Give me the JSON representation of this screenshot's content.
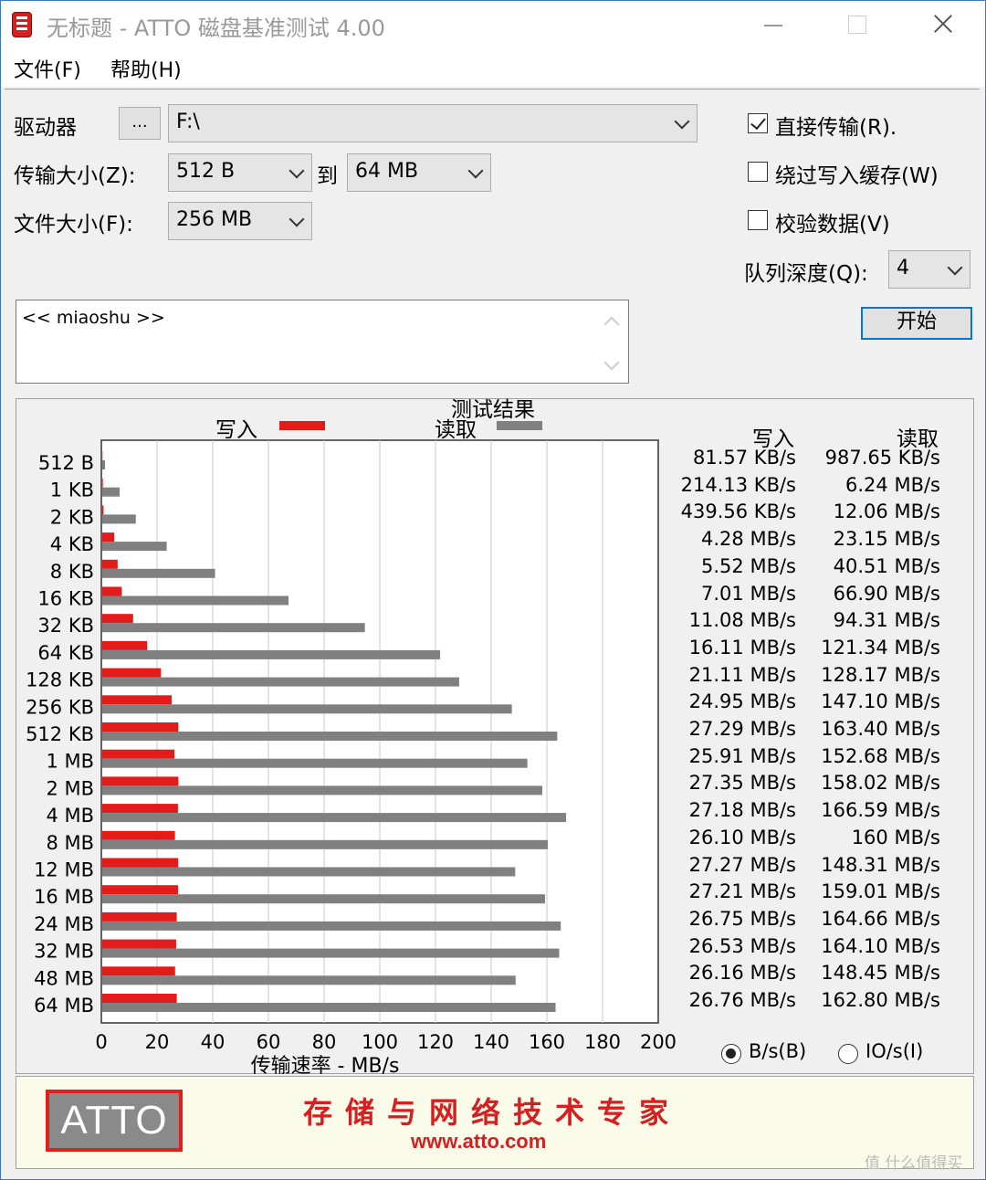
{
  "window": {
    "title": "无标题 - ATTO 磁盘基准测试 4.00"
  },
  "menu": [
    "文件(F)",
    "帮助(H)"
  ],
  "form": {
    "drive_label": "驱动器",
    "browse_button": "...",
    "drive_value": "F:\\",
    "transfer_size_label": "传输大小(Z):",
    "transfer_from": "512 B",
    "to_label": "到",
    "transfer_to": "64 MB",
    "file_size_label": "文件大小(F):",
    "file_size": "256 MB",
    "direct_io_label": "直接传输(R).",
    "direct_io_checked": true,
    "bypass_cache_label": "绕过写入缓存(W)",
    "bypass_cache_checked": false,
    "verify_label": "校验数据(V)",
    "verify_checked": false,
    "queue_depth_label": "队列深度(Q):",
    "queue_depth": "4",
    "start_button": "开始",
    "description": "<< miaoshu >>"
  },
  "results": {
    "title": "测试结果",
    "write_legend": "写入",
    "read_legend": "读取",
    "write_header": "写入",
    "read_header": "读取",
    "x_axis_label": "传输速率 - MB/s",
    "unit_bytes_label": "B/s(B)",
    "unit_io_label": "IO/s(I)",
    "unit_selected": "B/s",
    "rows": [
      {
        "size": "512 B",
        "write": "81.57 KB/s",
        "read": "987.65 KB/s"
      },
      {
        "size": "1 KB",
        "write": "214.13 KB/s",
        "read": "6.24 MB/s"
      },
      {
        "size": "2 KB",
        "write": "439.56 KB/s",
        "read": "12.06 MB/s"
      },
      {
        "size": "4 KB",
        "write": "4.28 MB/s",
        "read": "23.15 MB/s"
      },
      {
        "size": "8 KB",
        "write": "5.52 MB/s",
        "read": "40.51 MB/s"
      },
      {
        "size": "16 KB",
        "write": "7.01 MB/s",
        "read": "66.90 MB/s"
      },
      {
        "size": "32 KB",
        "write": "11.08 MB/s",
        "read": "94.31 MB/s"
      },
      {
        "size": "64 KB",
        "write": "16.11 MB/s",
        "read": "121.34 MB/s"
      },
      {
        "size": "128 KB",
        "write": "21.11 MB/s",
        "read": "128.17 MB/s"
      },
      {
        "size": "256 KB",
        "write": "24.95 MB/s",
        "read": "147.10 MB/s"
      },
      {
        "size": "512 KB",
        "write": "27.29 MB/s",
        "read": "163.40 MB/s"
      },
      {
        "size": "1 MB",
        "write": "25.91 MB/s",
        "read": "152.68 MB/s"
      },
      {
        "size": "2 MB",
        "write": "27.35 MB/s",
        "read": "158.02 MB/s"
      },
      {
        "size": "4 MB",
        "write": "27.18 MB/s",
        "read": "166.59 MB/s"
      },
      {
        "size": "8 MB",
        "write": "26.10 MB/s",
        "read": "160 MB/s"
      },
      {
        "size": "12 MB",
        "write": "27.27 MB/s",
        "read": "148.31 MB/s"
      },
      {
        "size": "16 MB",
        "write": "27.21 MB/s",
        "read": "159.01 MB/s"
      },
      {
        "size": "24 MB",
        "write": "26.75 MB/s",
        "read": "164.66 MB/s"
      },
      {
        "size": "32 MB",
        "write": "26.53 MB/s",
        "read": "164.10 MB/s"
      },
      {
        "size": "48 MB",
        "write": "26.16 MB/s",
        "read": "148.45 MB/s"
      },
      {
        "size": "64 MB",
        "write": "26.76 MB/s",
        "read": "162.80 MB/s"
      }
    ]
  },
  "chart_data": {
    "type": "bar",
    "orientation": "horizontal",
    "title": "测试结果",
    "xlabel": "传输速率 - MB/s",
    "ylabel": "",
    "xlim": [
      0,
      200
    ],
    "x_ticks": [
      0,
      20,
      40,
      60,
      80,
      100,
      120,
      140,
      160,
      180,
      200
    ],
    "grid": true,
    "legend_position": "top",
    "categories": [
      "512 B",
      "1 KB",
      "2 KB",
      "4 KB",
      "8 KB",
      "16 KB",
      "32 KB",
      "64 KB",
      "128 KB",
      "256 KB",
      "512 KB",
      "1 MB",
      "2 MB",
      "4 MB",
      "8 MB",
      "12 MB",
      "16 MB",
      "24 MB",
      "32 MB",
      "48 MB",
      "64 MB"
    ],
    "series": [
      {
        "name": "写入",
        "color": "#e41b1b",
        "values": [
          0.08,
          0.21,
          0.44,
          4.28,
          5.52,
          7.01,
          11.08,
          16.11,
          21.11,
          24.95,
          27.29,
          25.91,
          27.35,
          27.18,
          26.1,
          27.27,
          27.21,
          26.75,
          26.53,
          26.16,
          26.76
        ]
      },
      {
        "name": "读取",
        "color": "#808080",
        "values": [
          0.99,
          6.24,
          12.06,
          23.15,
          40.51,
          66.9,
          94.31,
          121.34,
          128.17,
          147.1,
          163.4,
          152.68,
          158.02,
          166.59,
          160,
          148.31,
          159.01,
          164.66,
          164.1,
          148.45,
          162.8
        ]
      }
    ]
  },
  "banner": {
    "logo": "ATTO",
    "slogan": "存储与网络技术专家",
    "url": "www.atto.com"
  },
  "watermark": "值 什么值得买"
}
